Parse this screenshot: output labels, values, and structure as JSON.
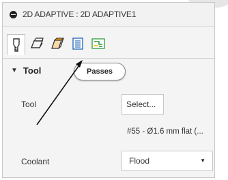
{
  "window": {
    "title": "2D ADAPTIVE : 2D ADAPTIVE1"
  },
  "tabs": [
    {
      "name": "tool-tab",
      "icon": "tool-bit-icon"
    },
    {
      "name": "geometry-tab",
      "icon": "geometry-icon"
    },
    {
      "name": "heights-tab",
      "icon": "heights-icon"
    },
    {
      "name": "passes-tab",
      "icon": "passes-icon"
    },
    {
      "name": "linking-tab",
      "icon": "linking-icon"
    }
  ],
  "tooltip": {
    "text": "Passes"
  },
  "tool_section": {
    "header": "Tool",
    "tool_label": "Tool",
    "select_button": "Select...",
    "tool_description": "#55 - Ø1.6 mm flat (...",
    "coolant_label": "Coolant",
    "coolant_value": "Flood"
  },
  "colors": {
    "heights_orange": "#f39c12",
    "linking_green": "#2e9a3e",
    "linking_yellow": "#f1c40f",
    "passes_blue": "#2a6ebd"
  }
}
